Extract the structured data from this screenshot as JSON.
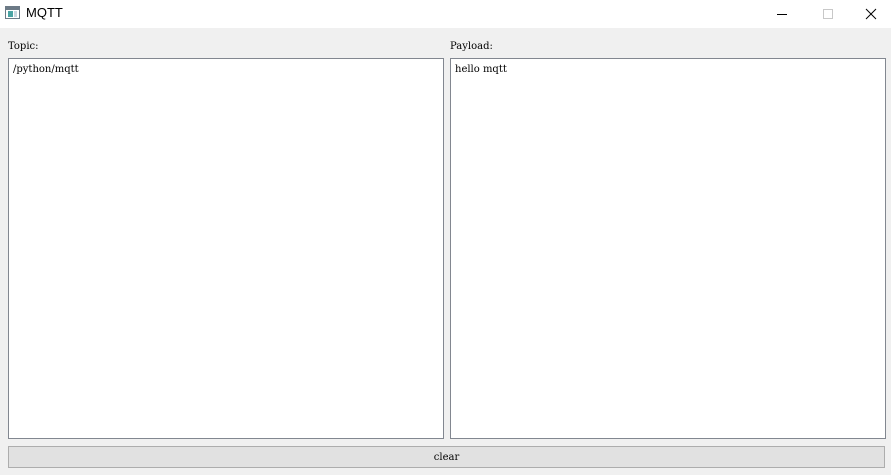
{
  "window": {
    "title": "MQTT",
    "icons": {
      "app": "app-window-icon",
      "minimize": "minimize-icon",
      "maximize": "maximize-icon",
      "close": "close-icon"
    }
  },
  "topic": {
    "label": "Topic:",
    "value": "/python/mqtt"
  },
  "payload": {
    "label": "Payload:",
    "value": "hello mqtt"
  },
  "actions": {
    "clear_label": "clear"
  },
  "colors": {
    "background": "#f0f0f0",
    "titlebar": "#ffffff",
    "textbox_border": "#828790",
    "button_face": "#e1e1e1",
    "button_border": "#adadad"
  }
}
